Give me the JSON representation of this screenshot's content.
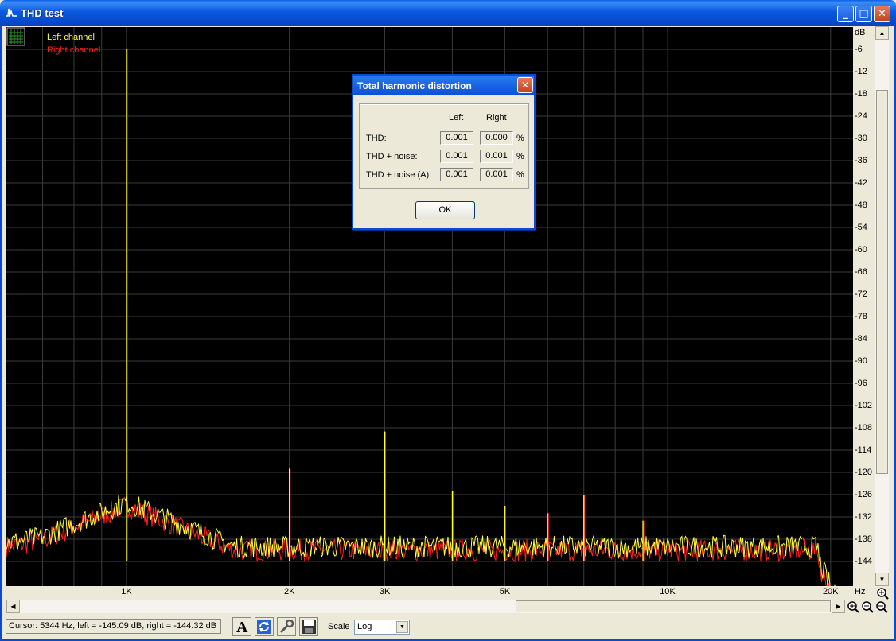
{
  "window": {
    "title": "THD test"
  },
  "legend": {
    "left": "Left channel",
    "right": "Right channel"
  },
  "colors": {
    "left": "#ffff40",
    "right": "#ff2020",
    "grid": "#3c3c3c",
    "plot_bg": "#000000"
  },
  "y_axis": {
    "unit": "dB",
    "labels": [
      "-6",
      "-12",
      "-18",
      "-24",
      "-30",
      "-36",
      "-42",
      "-48",
      "-54",
      "-60",
      "-66",
      "-72",
      "-78",
      "-84",
      "-90",
      "-96",
      "-102",
      "-108",
      "-114",
      "-120",
      "-126",
      "-132",
      "-138",
      "-144"
    ]
  },
  "x_axis": {
    "unit": "Hz",
    "labels": [
      "1K",
      "2K",
      "3K",
      "5K",
      "10K",
      "20K"
    ],
    "scale": "log"
  },
  "status": {
    "cursor": "Cursor:  5344 Hz,  left = -145.09 dB,  right = -144.32 dB"
  },
  "scale": {
    "label": "Scale",
    "value": "Log"
  },
  "dialog": {
    "title": "Total harmonic distortion",
    "col_left": "Left",
    "col_right": "Right",
    "rows": [
      {
        "label": "THD:",
        "left": "0.001",
        "right": "0.000",
        "unit": "%"
      },
      {
        "label": "THD + noise:",
        "left": "0.001",
        "right": "0.001",
        "unit": "%"
      },
      {
        "label": "THD + noise (A):",
        "left": "0.001",
        "right": "0.001",
        "unit": "%"
      }
    ],
    "ok": "OK"
  },
  "chart_data": {
    "type": "line",
    "x_scale": "log",
    "xlim": [
      600,
      22000
    ],
    "ylim": [
      -150,
      -3
    ],
    "y_unit": "dB",
    "x_unit": "Hz",
    "peaks": [
      {
        "x": 1000,
        "y": -6
      },
      {
        "x": 2000,
        "y": -119
      },
      {
        "x": 3000,
        "y": -109
      },
      {
        "x": 4000,
        "y": -125
      },
      {
        "x": 5000,
        "y": -129
      },
      {
        "x": 6000,
        "y": -131
      },
      {
        "x": 7000,
        "y": -126
      },
      {
        "x": 9000,
        "y": -133
      }
    ],
    "noise_floor": -144
  }
}
